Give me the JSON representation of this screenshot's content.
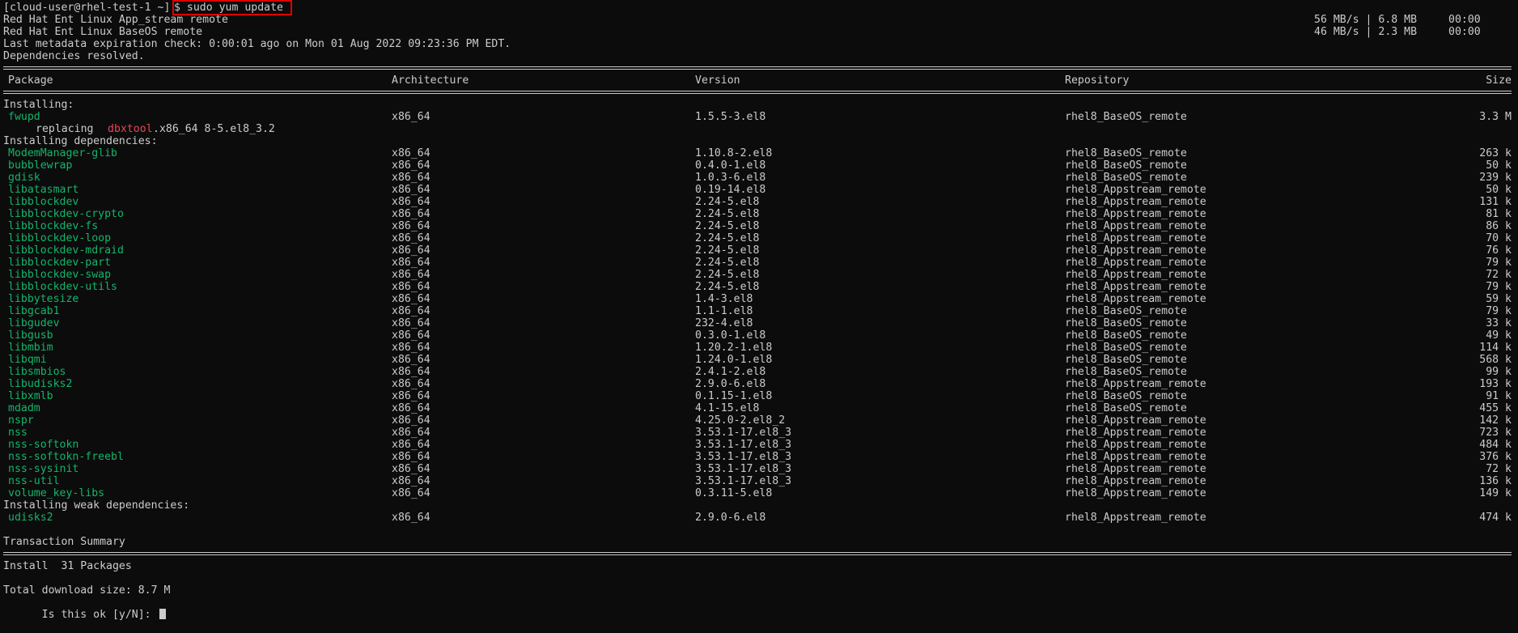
{
  "prompt": {
    "user_host": "[cloud-user@rhel-test-1 ~]",
    "command": "$ sudo yum update"
  },
  "repos": [
    {
      "name": "Red Hat Ent Linux App_stream remote",
      "speed": "56 MB/s | 6.8 MB",
      "time": "00:00"
    },
    {
      "name": "Red Hat Ent Linux BaseOS remote",
      "speed": "46 MB/s | 2.3 MB",
      "time": "00:00"
    }
  ],
  "metadata_line": "Last metadata expiration check: 0:00:01 ago on Mon 01 Aug 2022 09:23:36 PM EDT.",
  "deps_resolved": "Dependencies resolved.",
  "headers": {
    "package": "Package",
    "arch": "Architecture",
    "version": "Version",
    "repo": "Repository",
    "size": "Size"
  },
  "installing": {
    "title": "Installing:",
    "packages": [
      {
        "name": "fwupd",
        "arch": "x86_64",
        "version": "1.5.5-3.el8",
        "repo": "rhel8_BaseOS_remote",
        "size": "3.3 M"
      }
    ],
    "replacing": {
      "word": "replacing",
      "pkg": "dbxtool",
      "rest": ".x86_64 8-5.el8_3.2"
    }
  },
  "installing_deps": {
    "title": "Installing dependencies:",
    "packages": [
      {
        "name": "ModemManager-glib",
        "arch": "x86_64",
        "version": "1.10.8-2.el8",
        "repo": "rhel8_BaseOS_remote",
        "size": "263 k"
      },
      {
        "name": "bubblewrap",
        "arch": "x86_64",
        "version": "0.4.0-1.el8",
        "repo": "rhel8_BaseOS_remote",
        "size": "50 k"
      },
      {
        "name": "gdisk",
        "arch": "x86_64",
        "version": "1.0.3-6.el8",
        "repo": "rhel8_BaseOS_remote",
        "size": "239 k"
      },
      {
        "name": "libatasmart",
        "arch": "x86_64",
        "version": "0.19-14.el8",
        "repo": "rhel8_Appstream_remote",
        "size": "50 k"
      },
      {
        "name": "libblockdev",
        "arch": "x86_64",
        "version": "2.24-5.el8",
        "repo": "rhel8_Appstream_remote",
        "size": "131 k"
      },
      {
        "name": "libblockdev-crypto",
        "arch": "x86_64",
        "version": "2.24-5.el8",
        "repo": "rhel8_Appstream_remote",
        "size": "81 k"
      },
      {
        "name": "libblockdev-fs",
        "arch": "x86_64",
        "version": "2.24-5.el8",
        "repo": "rhel8_Appstream_remote",
        "size": "86 k"
      },
      {
        "name": "libblockdev-loop",
        "arch": "x86_64",
        "version": "2.24-5.el8",
        "repo": "rhel8_Appstream_remote",
        "size": "70 k"
      },
      {
        "name": "libblockdev-mdraid",
        "arch": "x86_64",
        "version": "2.24-5.el8",
        "repo": "rhel8_Appstream_remote",
        "size": "76 k"
      },
      {
        "name": "libblockdev-part",
        "arch": "x86_64",
        "version": "2.24-5.el8",
        "repo": "rhel8_Appstream_remote",
        "size": "79 k"
      },
      {
        "name": "libblockdev-swap",
        "arch": "x86_64",
        "version": "2.24-5.el8",
        "repo": "rhel8_Appstream_remote",
        "size": "72 k"
      },
      {
        "name": "libblockdev-utils",
        "arch": "x86_64",
        "version": "2.24-5.el8",
        "repo": "rhel8_Appstream_remote",
        "size": "79 k"
      },
      {
        "name": "libbytesize",
        "arch": "x86_64",
        "version": "1.4-3.el8",
        "repo": "rhel8_Appstream_remote",
        "size": "59 k"
      },
      {
        "name": "libgcab1",
        "arch": "x86_64",
        "version": "1.1-1.el8",
        "repo": "rhel8_BaseOS_remote",
        "size": "79 k"
      },
      {
        "name": "libgudev",
        "arch": "x86_64",
        "version": "232-4.el8",
        "repo": "rhel8_BaseOS_remote",
        "size": "33 k"
      },
      {
        "name": "libgusb",
        "arch": "x86_64",
        "version": "0.3.0-1.el8",
        "repo": "rhel8_BaseOS_remote",
        "size": "49 k"
      },
      {
        "name": "libmbim",
        "arch": "x86_64",
        "version": "1.20.2-1.el8",
        "repo": "rhel8_BaseOS_remote",
        "size": "114 k"
      },
      {
        "name": "libqmi",
        "arch": "x86_64",
        "version": "1.24.0-1.el8",
        "repo": "rhel8_BaseOS_remote",
        "size": "568 k"
      },
      {
        "name": "libsmbios",
        "arch": "x86_64",
        "version": "2.4.1-2.el8",
        "repo": "rhel8_BaseOS_remote",
        "size": "99 k"
      },
      {
        "name": "libudisks2",
        "arch": "x86_64",
        "version": "2.9.0-6.el8",
        "repo": "rhel8_Appstream_remote",
        "size": "193 k"
      },
      {
        "name": "libxmlb",
        "arch": "x86_64",
        "version": "0.1.15-1.el8",
        "repo": "rhel8_BaseOS_remote",
        "size": "91 k"
      },
      {
        "name": "mdadm",
        "arch": "x86_64",
        "version": "4.1-15.el8",
        "repo": "rhel8_BaseOS_remote",
        "size": "455 k"
      },
      {
        "name": "nspr",
        "arch": "x86_64",
        "version": "4.25.0-2.el8_2",
        "repo": "rhel8_Appstream_remote",
        "size": "142 k"
      },
      {
        "name": "nss",
        "arch": "x86_64",
        "version": "3.53.1-17.el8_3",
        "repo": "rhel8_Appstream_remote",
        "size": "723 k"
      },
      {
        "name": "nss-softokn",
        "arch": "x86_64",
        "version": "3.53.1-17.el8_3",
        "repo": "rhel8_Appstream_remote",
        "size": "484 k"
      },
      {
        "name": "nss-softokn-freebl",
        "arch": "x86_64",
        "version": "3.53.1-17.el8_3",
        "repo": "rhel8_Appstream_remote",
        "size": "376 k"
      },
      {
        "name": "nss-sysinit",
        "arch": "x86_64",
        "version": "3.53.1-17.el8_3",
        "repo": "rhel8_Appstream_remote",
        "size": "72 k"
      },
      {
        "name": "nss-util",
        "arch": "x86_64",
        "version": "3.53.1-17.el8_3",
        "repo": "rhel8_Appstream_remote",
        "size": "136 k"
      },
      {
        "name": "volume_key-libs",
        "arch": "x86_64",
        "version": "0.3.11-5.el8",
        "repo": "rhel8_Appstream_remote",
        "size": "149 k"
      }
    ]
  },
  "installing_weak": {
    "title": "Installing weak dependencies:",
    "packages": [
      {
        "name": "udisks2",
        "arch": "x86_64",
        "version": "2.9.0-6.el8",
        "repo": "rhel8_Appstream_remote",
        "size": "474 k"
      }
    ]
  },
  "summary": {
    "title": "Transaction Summary",
    "install_line": "Install  31 Packages",
    "download_size": "Total download size: 8.7 M",
    "confirm_prompt": "Is this ok [y/N]: "
  },
  "colors": {
    "background": "#0c0c0c",
    "foreground": "#cccccc",
    "package_green": "#13b56b",
    "replaced_red": "#e74856",
    "highlight_box": "#e00000"
  }
}
